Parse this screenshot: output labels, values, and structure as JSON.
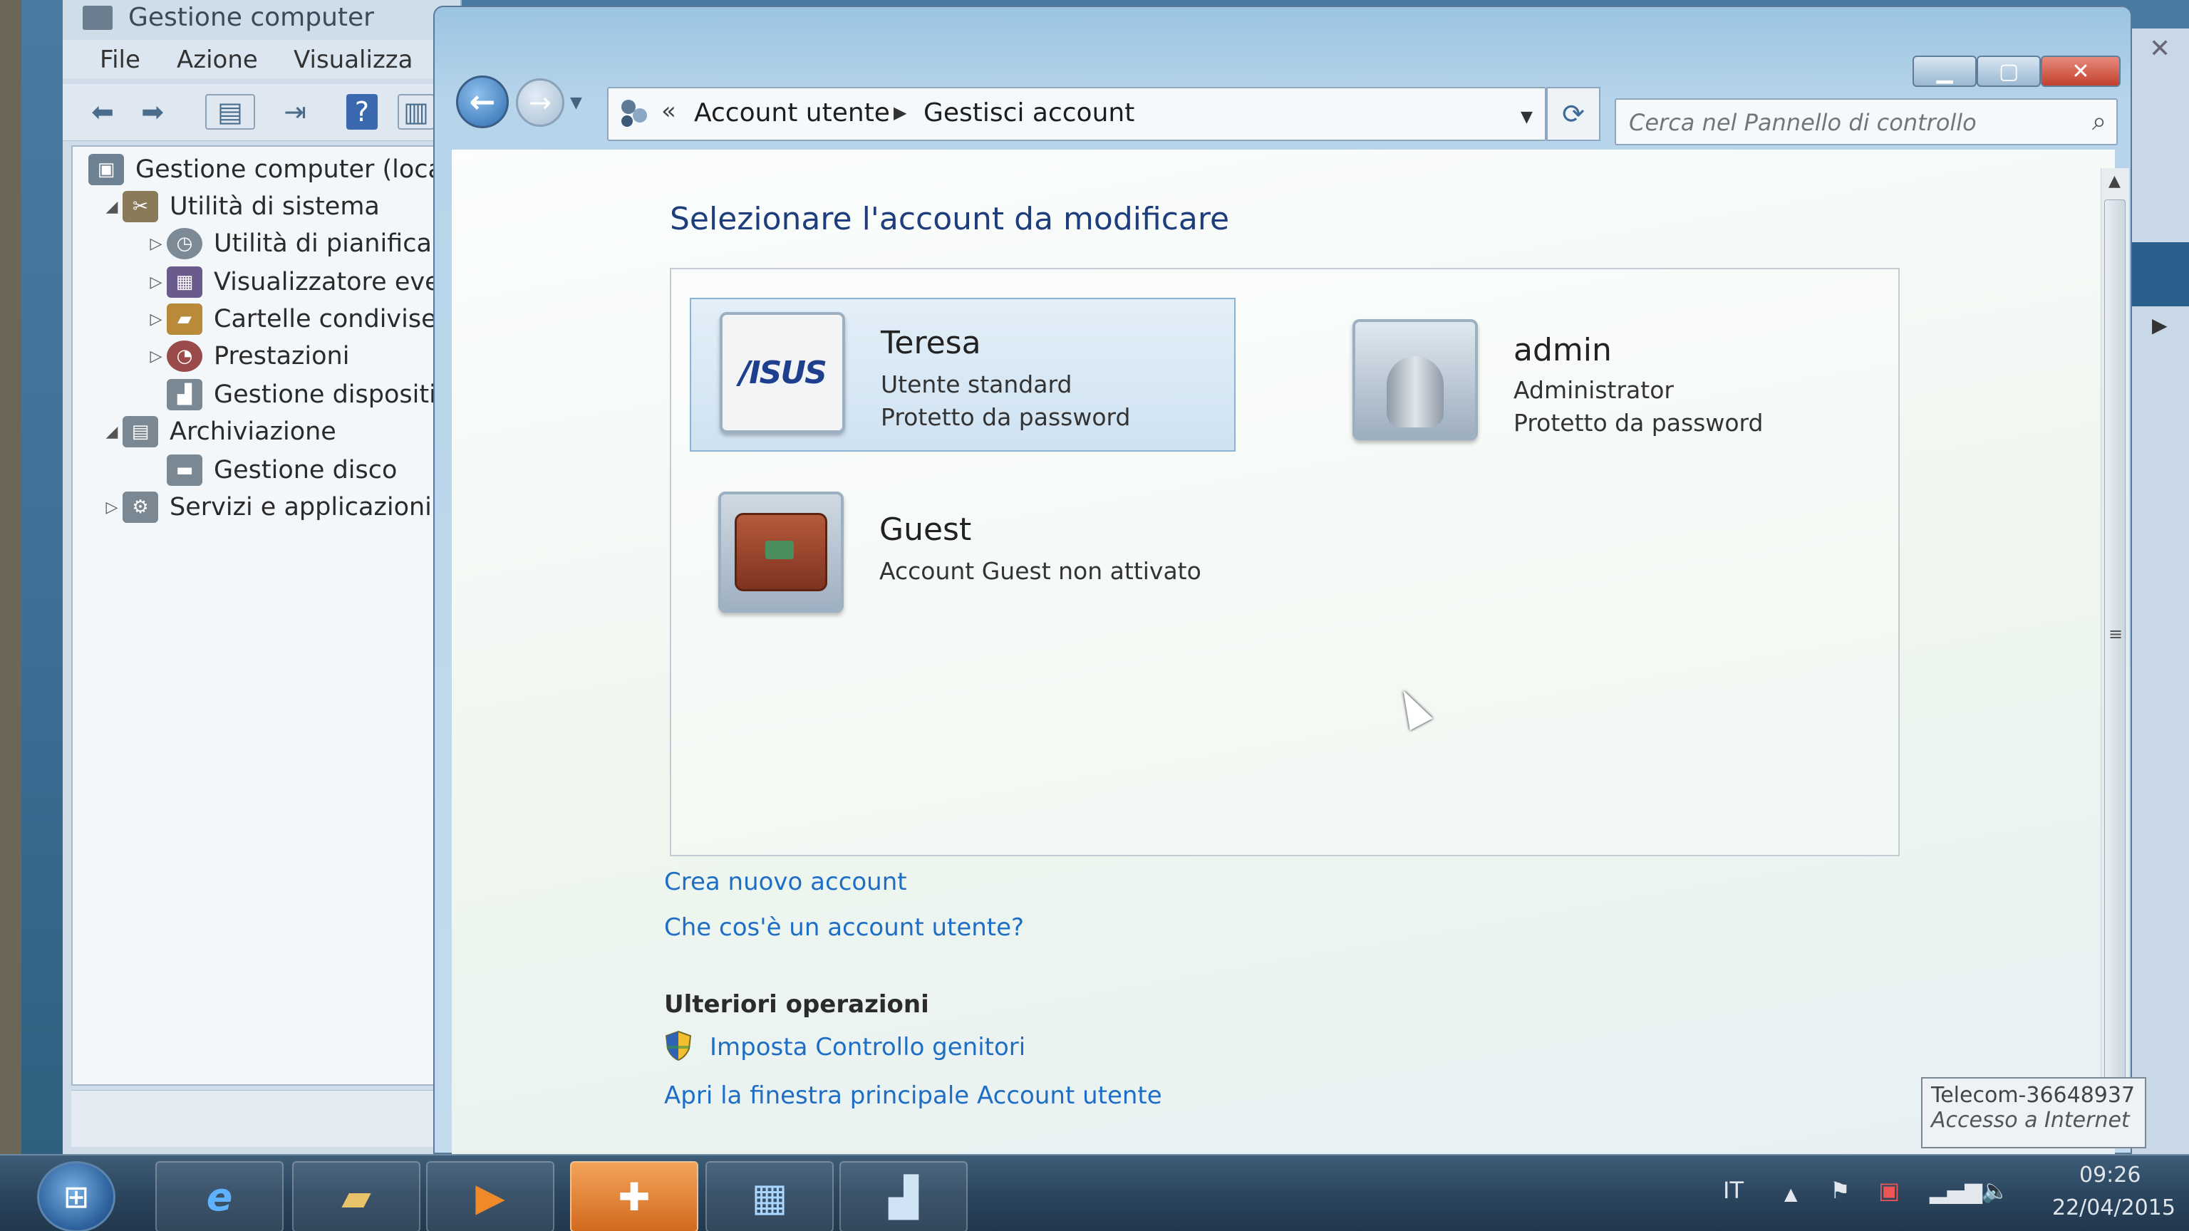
{
  "colors": {
    "link": "#1f6ec6",
    "heading": "#1e3d7c",
    "close": "#c2402d",
    "active_task": "#e27a2a"
  },
  "mmc": {
    "title": "Gestione computer",
    "menu": [
      "File",
      "Azione",
      "Visualizza"
    ],
    "tree": {
      "root": "Gestione computer (loca",
      "system_tools": "Utilità di sistema",
      "scheduler": "Utilità di pianifica",
      "event_viewer": "Visualizzatore eve",
      "shared_folders": "Cartelle condivise",
      "performance": "Prestazioni",
      "device_manager": "Gestione dispositi",
      "storage": "Archiviazione",
      "disk_mgmt": "Gestione disco",
      "services": "Servizi e applicazioni"
    }
  },
  "window": {
    "breadcrumb": {
      "overflow": "«",
      "item1": "Account utente",
      "item2": "Gestisci account"
    },
    "search_placeholder": "Cerca nel Pannello di controllo"
  },
  "content": {
    "heading": "Selezionare l'account da modificare",
    "accounts": [
      {
        "name": "Teresa",
        "line1": "Utente standard",
        "line2": "Protetto da password",
        "picture": "asus-logo",
        "selected": true
      },
      {
        "name": "admin",
        "line1": "Administrator",
        "line2": "Protetto da password",
        "picture": "robot-icon",
        "selected": false
      },
      {
        "name": "Guest",
        "line1": "Account Guest non attivato",
        "picture": "suitcase-icon",
        "selected": false
      }
    ],
    "asus_logo_text": "/ISUS",
    "links": {
      "create": "Crea nuovo account",
      "what_is": "Che cos'è un account utente?"
    },
    "more_heading": "Ulteriori operazioni",
    "parental": "Imposta Controllo genitori",
    "main_window": "Apri la finestra principale Account utente"
  },
  "tooltip": {
    "line1": "Telecom-36648937",
    "line2": "Accesso a Internet"
  },
  "taskbar": {
    "lang": "IT",
    "time": "09:26",
    "date": "22/04/2015"
  }
}
